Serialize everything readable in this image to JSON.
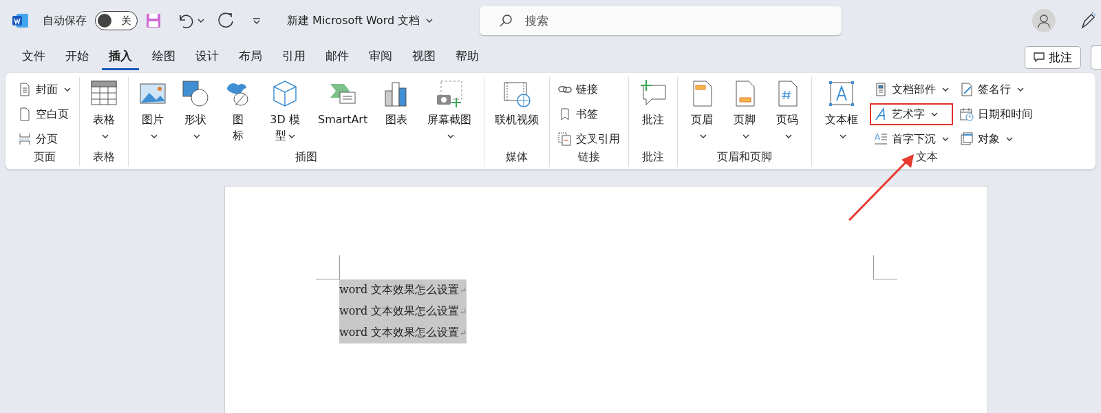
{
  "titlebar": {
    "autosave_label": "自动保存",
    "autosave_toggle": {
      "label": "关",
      "on": false
    },
    "document_title": "新建 Microsoft Word 文档",
    "search": {
      "placeholder": "搜索"
    }
  },
  "tabs": [
    {
      "label": "文件",
      "selected": false
    },
    {
      "label": "开始",
      "selected": false
    },
    {
      "label": "插入",
      "selected": true
    },
    {
      "label": "绘图",
      "selected": false
    },
    {
      "label": "设计",
      "selected": false
    },
    {
      "label": "布局",
      "selected": false
    },
    {
      "label": "引用",
      "selected": false
    },
    {
      "label": "邮件",
      "selected": false
    },
    {
      "label": "审阅",
      "selected": false
    },
    {
      "label": "视图",
      "selected": false
    },
    {
      "label": "帮助",
      "selected": false
    }
  ],
  "comment_button": "批注",
  "ribbon": {
    "groups": [
      {
        "label": "页面",
        "items": [
          {
            "kind": "column",
            "items": [
              {
                "label": "封面",
                "dropdown": true,
                "highlighted": false
              },
              {
                "label": "空白页",
                "dropdown": false,
                "highlighted": false
              },
              {
                "label": "分页",
                "dropdown": false,
                "highlighted": false
              }
            ]
          }
        ]
      },
      {
        "label": "表格",
        "items": [
          {
            "kind": "large",
            "label": "表格",
            "dropdown": true
          }
        ]
      },
      {
        "label": "插图",
        "items": [
          {
            "kind": "large",
            "label": "图片",
            "dropdown": true
          },
          {
            "kind": "large",
            "label": "形状",
            "dropdown": true
          },
          {
            "kind": "large",
            "label": "图标",
            "dropdown": false
          },
          {
            "kind": "large",
            "label": "3D 模型",
            "dropdown": true
          },
          {
            "kind": "large",
            "label": "SmartArt",
            "dropdown": false
          },
          {
            "kind": "large",
            "label": "图表",
            "dropdown": false
          },
          {
            "kind": "large",
            "label": "屏幕截图",
            "dropdown": true
          }
        ]
      },
      {
        "label": "媒体",
        "items": [
          {
            "kind": "large",
            "label": "联机视频",
            "dropdown": false
          }
        ]
      },
      {
        "label": "链接",
        "items": [
          {
            "kind": "column",
            "items": [
              {
                "label": "链接",
                "dropdown": false,
                "highlighted": false
              },
              {
                "label": "书签",
                "dropdown": false,
                "highlighted": false
              },
              {
                "label": "交叉引用",
                "dropdown": false,
                "highlighted": false
              }
            ]
          }
        ]
      },
      {
        "label": "批注",
        "items": [
          {
            "kind": "large",
            "label": "批注",
            "dropdown": false
          }
        ]
      },
      {
        "label": "页眉和页脚",
        "items": [
          {
            "kind": "large",
            "label": "页眉",
            "dropdown": true
          },
          {
            "kind": "large",
            "label": "页脚",
            "dropdown": true
          },
          {
            "kind": "large",
            "label": "页码",
            "dropdown": true
          }
        ]
      },
      {
        "label": "文本",
        "items": [
          {
            "kind": "large",
            "label": "文本框",
            "dropdown": true
          },
          {
            "kind": "column",
            "items": [
              {
                "label": "文档部件",
                "dropdown": true,
                "highlighted": false
              },
              {
                "label": "艺术字",
                "dropdown": true,
                "highlighted": true
              },
              {
                "label": "首字下沉",
                "dropdown": true,
                "highlighted": false
              }
            ]
          },
          {
            "kind": "column",
            "items": [
              {
                "label": "签名行",
                "dropdown": true,
                "highlighted": false
              },
              {
                "label": "日期和时间",
                "dropdown": false,
                "highlighted": false
              },
              {
                "label": "对象",
                "dropdown": true,
                "highlighted": false
              }
            ]
          }
        ]
      }
    ]
  },
  "pointer_arrow": true,
  "document": {
    "lines": [
      {
        "text": "word 文本效果怎么设置",
        "mark": "↵",
        "selected": true
      },
      {
        "text": "word 文本效果怎么设置",
        "mark": "↵",
        "selected": true
      },
      {
        "text": "word 文本效果怎么设置",
        "mark": "↵",
        "selected": true
      }
    ]
  }
}
